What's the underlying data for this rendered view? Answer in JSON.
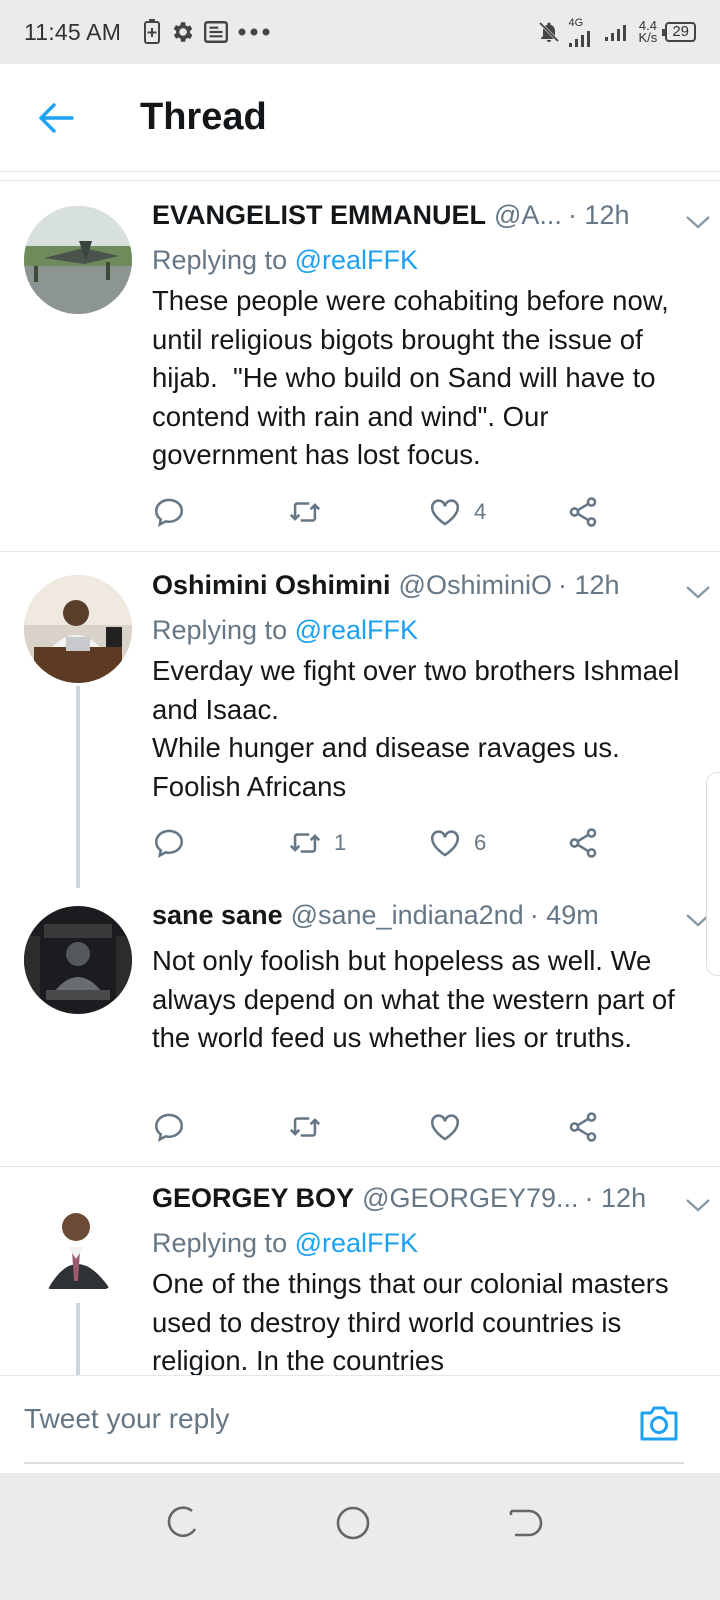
{
  "status_bar": {
    "time": "11:45 AM",
    "network": "4G",
    "speed_value": "4.4",
    "speed_unit": "K/s",
    "battery": "29"
  },
  "header": {
    "title": "Thread"
  },
  "tweets": [
    {
      "name": "EVANGELIST EMMANUEL",
      "handle": "@A...",
      "time": "· 12h",
      "replying_prefix": "Replying to ",
      "replying_to": "@realFFK",
      "text": "These people were cohabiting before now, until religious bigots brought the issue of hijab.  \"He who build on Sand will have to contend with rain and wind\". Our government has lost focus.",
      "retweets": "",
      "likes": "4"
    },
    {
      "name": "Oshimini Oshimini",
      "handle": "@OshiminiO",
      "time": "· 12h",
      "replying_prefix": "Replying to ",
      "replying_to": "@realFFK",
      "text": "Everday we fight over two brothers Ishmael and Isaac.\nWhile hunger and disease ravages us. Foolish Africans",
      "retweets": "1",
      "likes": "6"
    },
    {
      "name": "sane sane",
      "handle": "@sane_indiana2nd",
      "time": "· 49m",
      "text": "Not only foolish but hopeless as well. We always depend on what the western part of the world feed us whether lies or truths.",
      "retweets": "",
      "likes": ""
    },
    {
      "name": "GEORGEY BOY",
      "handle": "@GEORGEY79...",
      "time": "· 12h",
      "replying_prefix": "Replying to ",
      "replying_to": "@realFFK",
      "text": "One of the things that our colonial masters used to destroy third world countries is religion. In the countries"
    }
  ],
  "reply": {
    "placeholder": "Tweet your reply"
  },
  "colors": {
    "accent": "#1da1f2",
    "secondary_text": "#657786",
    "divider": "#e1e8ed"
  }
}
